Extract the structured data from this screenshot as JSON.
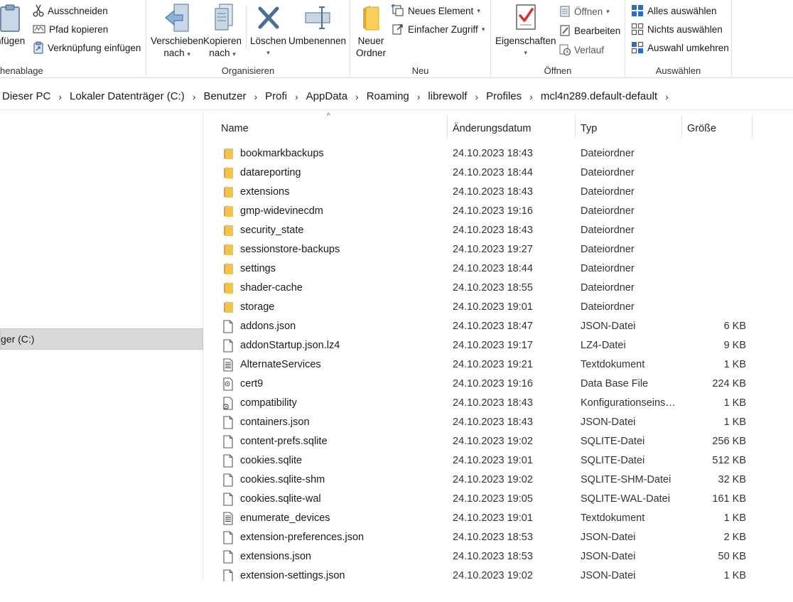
{
  "ribbon": {
    "clipboard": {
      "paste_label": "nfügen",
      "cut_label": "Ausschneiden",
      "copy_path_label": "Pfad kopieren",
      "paste_shortcut_label": "Verknüpfung einfügen",
      "group_label": "henablage"
    },
    "organize": {
      "move_to_line1": "Verschieben",
      "move_to_line2": "nach",
      "copy_to_line1": "Kopieren",
      "copy_to_line2": "nach",
      "delete_label": "Löschen",
      "rename_label": "Umbenennen",
      "group_label": "Organisieren"
    },
    "new": {
      "new_folder_line1": "Neuer",
      "new_folder_line2": "Ordner",
      "new_item_label": "Neues Element",
      "easy_access_label": "Einfacher Zugriff",
      "group_label": "Neu"
    },
    "open": {
      "properties_label": "Eigenschaften",
      "open_label": "Öffnen",
      "edit_label": "Bearbeiten",
      "history_label": "Verlauf",
      "group_label": "Öffnen"
    },
    "select": {
      "select_all_label": "Alles auswählen",
      "select_none_label": "Nichts auswählen",
      "invert_selection_label": "Auswahl umkehren",
      "group_label": "Auswählen"
    }
  },
  "breadcrumb": [
    "Dieser PC",
    "Lokaler Datenträger (C:)",
    "Benutzer",
    "Profi",
    "AppData",
    "Roaming",
    "librewolf",
    "Profiles",
    "mcl4n289.default-default"
  ],
  "nav": {
    "selected_label": "ger (C:)"
  },
  "columns": {
    "name": "Name",
    "date": "Änderungsdatum",
    "type": "Typ",
    "size": "Größe"
  },
  "files": [
    {
      "name": "bookmarkbackups",
      "date": "24.10.2023 18:43",
      "type": "Dateiordner",
      "size": "",
      "icon": "folder"
    },
    {
      "name": "datareporting",
      "date": "24.10.2023 18:44",
      "type": "Dateiordner",
      "size": "",
      "icon": "folder"
    },
    {
      "name": "extensions",
      "date": "24.10.2023 18:43",
      "type": "Dateiordner",
      "size": "",
      "icon": "folder"
    },
    {
      "name": "gmp-widevinecdm",
      "date": "24.10.2023 19:16",
      "type": "Dateiordner",
      "size": "",
      "icon": "folder"
    },
    {
      "name": "security_state",
      "date": "24.10.2023 18:43",
      "type": "Dateiordner",
      "size": "",
      "icon": "folder"
    },
    {
      "name": "sessionstore-backups",
      "date": "24.10.2023 19:27",
      "type": "Dateiordner",
      "size": "",
      "icon": "folder"
    },
    {
      "name": "settings",
      "date": "24.10.2023 18:44",
      "type": "Dateiordner",
      "size": "",
      "icon": "folder"
    },
    {
      "name": "shader-cache",
      "date": "24.10.2023 18:55",
      "type": "Dateiordner",
      "size": "",
      "icon": "folder"
    },
    {
      "name": "storage",
      "date": "24.10.2023 19:01",
      "type": "Dateiordner",
      "size": "",
      "icon": "folder"
    },
    {
      "name": "addons.json",
      "date": "24.10.2023 18:47",
      "type": "JSON-Datei",
      "size": "6 KB",
      "icon": "file"
    },
    {
      "name": "addonStartup.json.lz4",
      "date": "24.10.2023 19:17",
      "type": "LZ4-Datei",
      "size": "9 KB",
      "icon": "file"
    },
    {
      "name": "AlternateServices",
      "date": "24.10.2023 19:21",
      "type": "Textdokument",
      "size": "1 KB",
      "icon": "text"
    },
    {
      "name": "cert9",
      "date": "24.10.2023 19:16",
      "type": "Data Base File",
      "size": "224 KB",
      "icon": "db"
    },
    {
      "name": "compatibility",
      "date": "24.10.2023 18:43",
      "type": "Konfigurationseins…",
      "size": "1 KB",
      "icon": "config"
    },
    {
      "name": "containers.json",
      "date": "24.10.2023 18:43",
      "type": "JSON-Datei",
      "size": "1 KB",
      "icon": "file"
    },
    {
      "name": "content-prefs.sqlite",
      "date": "24.10.2023 19:02",
      "type": "SQLITE-Datei",
      "size": "256 KB",
      "icon": "file"
    },
    {
      "name": "cookies.sqlite",
      "date": "24.10.2023 19:01",
      "type": "SQLITE-Datei",
      "size": "512 KB",
      "icon": "file"
    },
    {
      "name": "cookies.sqlite-shm",
      "date": "24.10.2023 19:02",
      "type": "SQLITE-SHM-Datei",
      "size": "32 KB",
      "icon": "file"
    },
    {
      "name": "cookies.sqlite-wal",
      "date": "24.10.2023 19:05",
      "type": "SQLITE-WAL-Datei",
      "size": "161 KB",
      "icon": "file"
    },
    {
      "name": "enumerate_devices",
      "date": "24.10.2023 19:01",
      "type": "Textdokument",
      "size": "1 KB",
      "icon": "text"
    },
    {
      "name": "extension-preferences.json",
      "date": "24.10.2023 18:53",
      "type": "JSON-Datei",
      "size": "2 KB",
      "icon": "file"
    },
    {
      "name": "extensions.json",
      "date": "24.10.2023 18:53",
      "type": "JSON-Datei",
      "size": "50 KB",
      "icon": "file"
    },
    {
      "name": "extension-settings.json",
      "date": "24.10.2023 19:02",
      "type": "JSON-Datei",
      "size": "1 KB",
      "icon": "file"
    }
  ],
  "colors": {
    "folder": "#f3c44d",
    "accent": "#2b6cc4",
    "selected_bg": "#d9d9d9"
  }
}
